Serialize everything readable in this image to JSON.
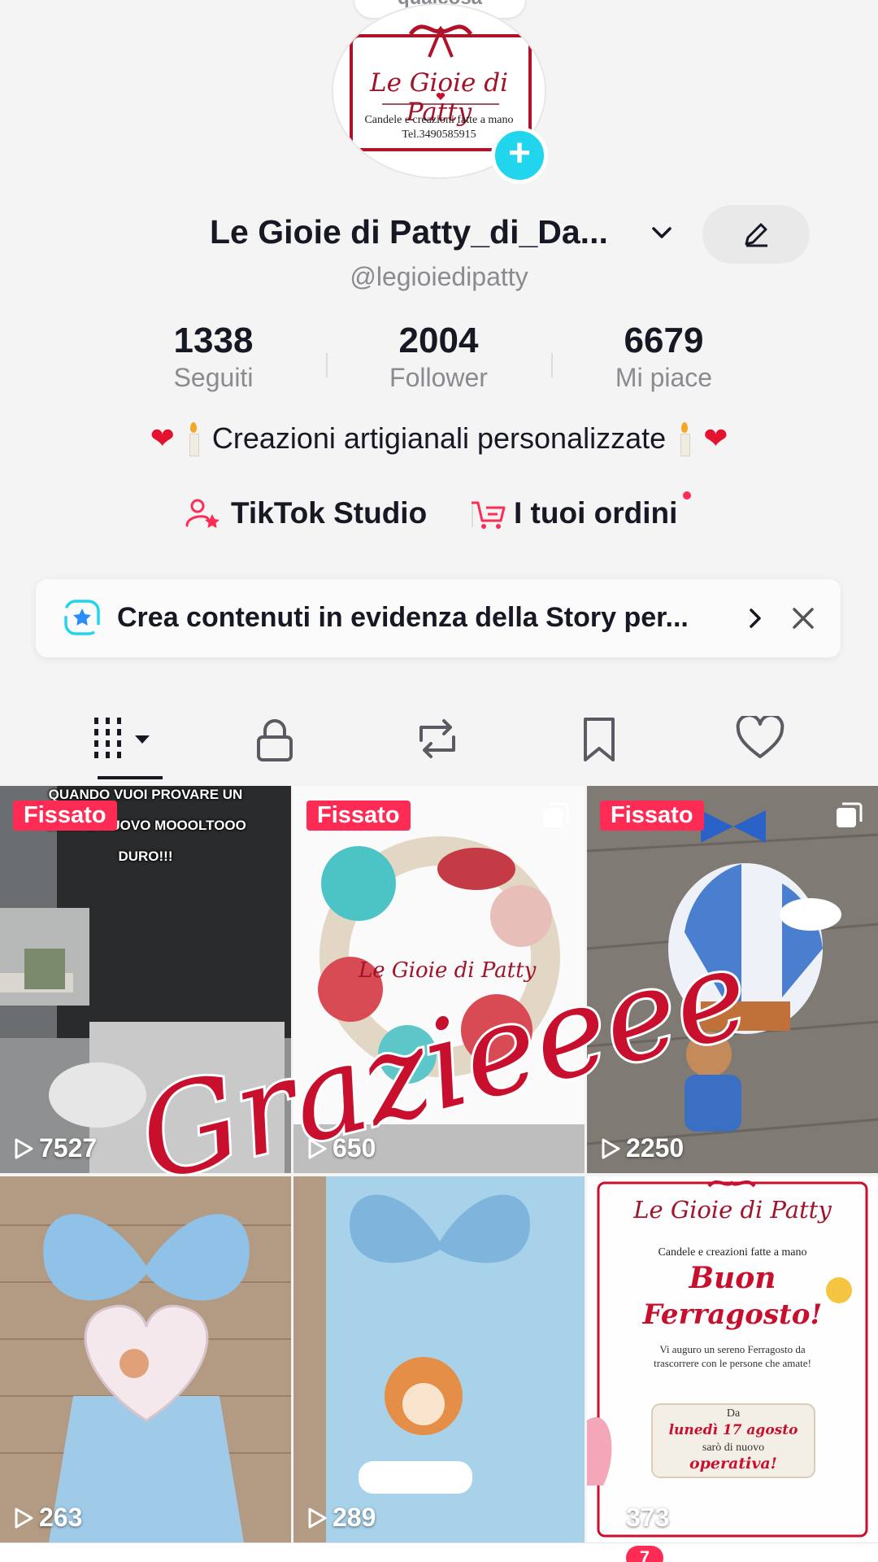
{
  "top_chip": {
    "label": "qualcosa"
  },
  "avatar": {
    "logo_title": "Le Gioie di Patty",
    "logo_subtitle": "Candele e creazioni fatte a mano",
    "logo_phone": "Tel.3490585915"
  },
  "profile": {
    "name": "Le Gioie di Patty_di_Da...",
    "handle": "@legioiedipatty"
  },
  "stats": [
    {
      "value": "1338",
      "label": "Seguiti"
    },
    {
      "value": "2004",
      "label": "Follower"
    },
    {
      "value": "6679",
      "label": "Mi piace"
    }
  ],
  "bio": {
    "text": "Creazioni artigianali personalizzate"
  },
  "links": {
    "studio": "TikTok Studio",
    "orders": "I tuoi ordini"
  },
  "banner": {
    "text": "Crea contenuti in evidenza della Story per..."
  },
  "tabs": [
    "videos",
    "private",
    "reposts",
    "saved",
    "liked"
  ],
  "grid": {
    "pinned_label": "Fissato",
    "items": [
      {
        "views": "7527",
        "pinned": true,
        "caption": "QUANDO VUOI PROVARE UN CAMPO NUOVO MOOOLTOOO DURO!!!"
      },
      {
        "views": "650",
        "pinned": true
      },
      {
        "views": "2250",
        "pinned": true
      },
      {
        "views": "263",
        "pinned": false
      },
      {
        "views": "289",
        "pinned": false
      },
      {
        "views": "373",
        "pinned": false,
        "poster": {
          "brand": "Le Gioie di Patty",
          "sub": "Candele e creazioni fatte a mano",
          "headline1": "Buon",
          "headline2": "Ferragosto!",
          "body": "Vi auguro un sereno Ferragosto da trascorrere con le persone che amate!",
          "date_intro": "Da",
          "date": "lunedì 17 agosto",
          "date_after": "sarò di nuovo",
          "date_end": "operativa!"
        }
      }
    ]
  },
  "overlay": {
    "text": "Grazieeee"
  },
  "nav": {
    "inbox_badge": "7"
  },
  "colors": {
    "accent": "#fe2c55",
    "add_button": "#20d5ec",
    "overlay_red": "#c8102e"
  }
}
